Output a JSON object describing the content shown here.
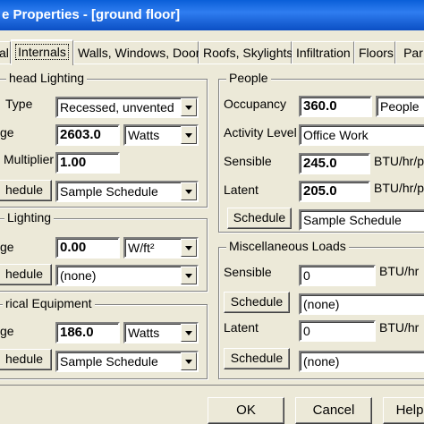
{
  "window": {
    "title": "e Properties - [ground floor]"
  },
  "tabs": [
    "al",
    "Internals",
    "Walls, Windows, Doors",
    "Roofs, Skylights",
    "Infiltration",
    "Floors",
    "Par"
  ],
  "overhead_lighting": {
    "legend": "head Lighting",
    "type_label": "Type",
    "type_value": "Recessed, unvented",
    "wattage_label": "ge",
    "wattage_value": "2603.0",
    "wattage_units": "Watts",
    "multiplier_label": "Multiplier",
    "multiplier_value": "1.00",
    "schedule_button": "hedule",
    "schedule_value": "Sample Schedule"
  },
  "task_lighting": {
    "legend": "Lighting",
    "wattage_label": "ge",
    "wattage_value": "0.00",
    "wattage_units": "W/ft²",
    "schedule_button": "hedule",
    "schedule_value": "(none)"
  },
  "equipment": {
    "legend": "rical Equipment",
    "wattage_label": "ge",
    "wattage_value": "186.0",
    "wattage_units": "Watts",
    "schedule_button": "hedule",
    "schedule_value": "Sample Schedule"
  },
  "people": {
    "legend": "People",
    "occupancy_label": "Occupancy",
    "occupancy_value": "360.0",
    "occupancy_units": "People",
    "activity_label": "Activity Level",
    "activity_value": "Office Work",
    "sensible_label": "Sensible",
    "sensible_value": "245.0",
    "sensible_units": "BTU/hr/p",
    "latent_label": "Latent",
    "latent_value": "205.0",
    "latent_units": "BTU/hr/p",
    "schedule_button": "Schedule",
    "schedule_value": "Sample Schedule"
  },
  "misc_loads": {
    "legend": "Miscellaneous Loads",
    "sensible_label": "Sensible",
    "sensible_value": "0",
    "sensible_units": "BTU/hr",
    "sensible_schedule_button": "Schedule",
    "sensible_schedule_value": "(none)",
    "latent_label": "Latent",
    "latent_value": "0",
    "latent_units": "BTU/hr",
    "latent_schedule_button": "Schedule",
    "latent_schedule_value": "(none)"
  },
  "footer": {
    "ok": "OK",
    "cancel": "Cancel",
    "help": "Help"
  }
}
